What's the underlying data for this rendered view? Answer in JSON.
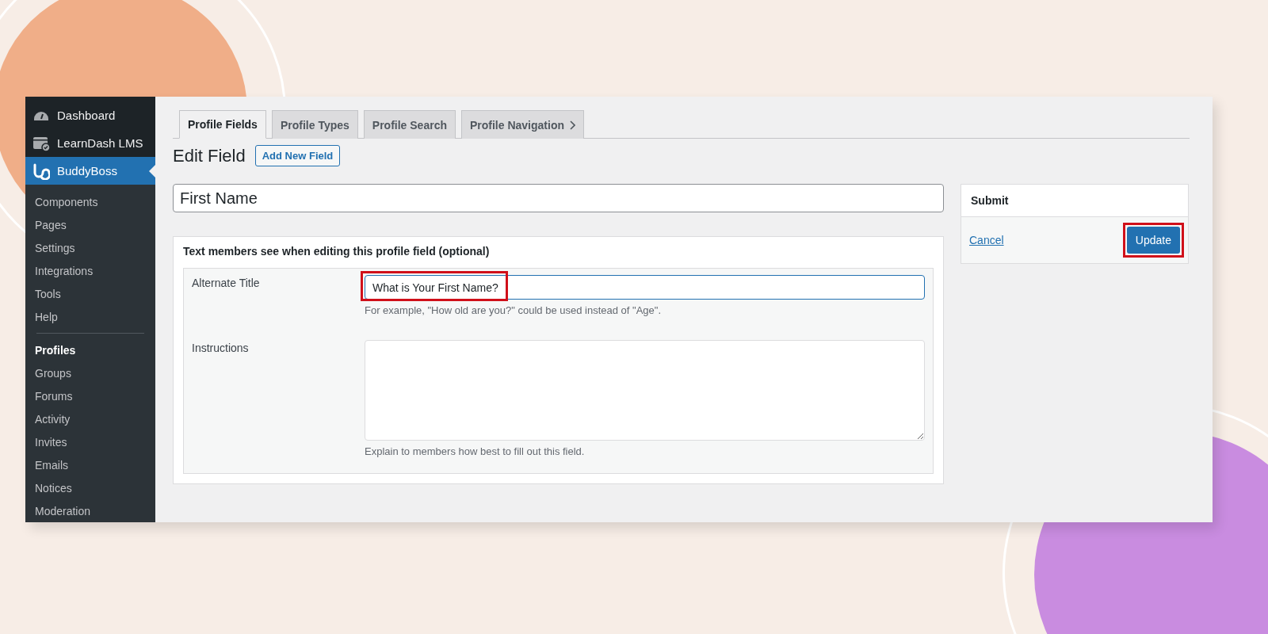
{
  "sidebar": {
    "menu": [
      {
        "label": "Dashboard",
        "selected": false
      },
      {
        "label": "LearnDash LMS",
        "selected": false
      },
      {
        "label": "BuddyBoss",
        "selected": true
      }
    ],
    "submenu": [
      [
        {
          "label": "Components",
          "selected": false
        },
        {
          "label": "Pages",
          "selected": false
        },
        {
          "label": "Settings",
          "selected": false
        },
        {
          "label": "Integrations",
          "selected": false
        },
        {
          "label": "Tools",
          "selected": false
        },
        {
          "label": "Help",
          "selected": false
        }
      ],
      [
        {
          "label": "Profiles",
          "selected": true
        },
        {
          "label": "Groups",
          "selected": false
        },
        {
          "label": "Forums",
          "selected": false
        },
        {
          "label": "Activity",
          "selected": false
        },
        {
          "label": "Invites",
          "selected": false
        },
        {
          "label": "Emails",
          "selected": false
        },
        {
          "label": "Notices",
          "selected": false
        },
        {
          "label": "Moderation",
          "selected": false
        }
      ]
    ]
  },
  "tabs": [
    {
      "label": "Profile Fields",
      "selected": true
    },
    {
      "label": "Profile Types",
      "selected": false
    },
    {
      "label": "Profile Search",
      "selected": false
    },
    {
      "label": "Profile Navigation",
      "selected": false,
      "chevron": true
    }
  ],
  "heading": "Edit Field",
  "add_button": "Add New Field",
  "field_name": "First Name",
  "box": {
    "title": "Text members see when editing this profile field (optional)",
    "rows": [
      {
        "kind": "input",
        "label": "Alternate Title",
        "value": "What is Your First Name?",
        "highlighted": true,
        "hint": "For example, \"How old are you?\" could be used instead of \"Age\"."
      },
      {
        "kind": "textarea",
        "label": "Instructions",
        "value": "",
        "hint": "Explain to members how best to fill out this field."
      }
    ]
  },
  "submit": {
    "title": "Submit",
    "cancel": "Cancel",
    "update": "Update",
    "highlighted": true
  }
}
